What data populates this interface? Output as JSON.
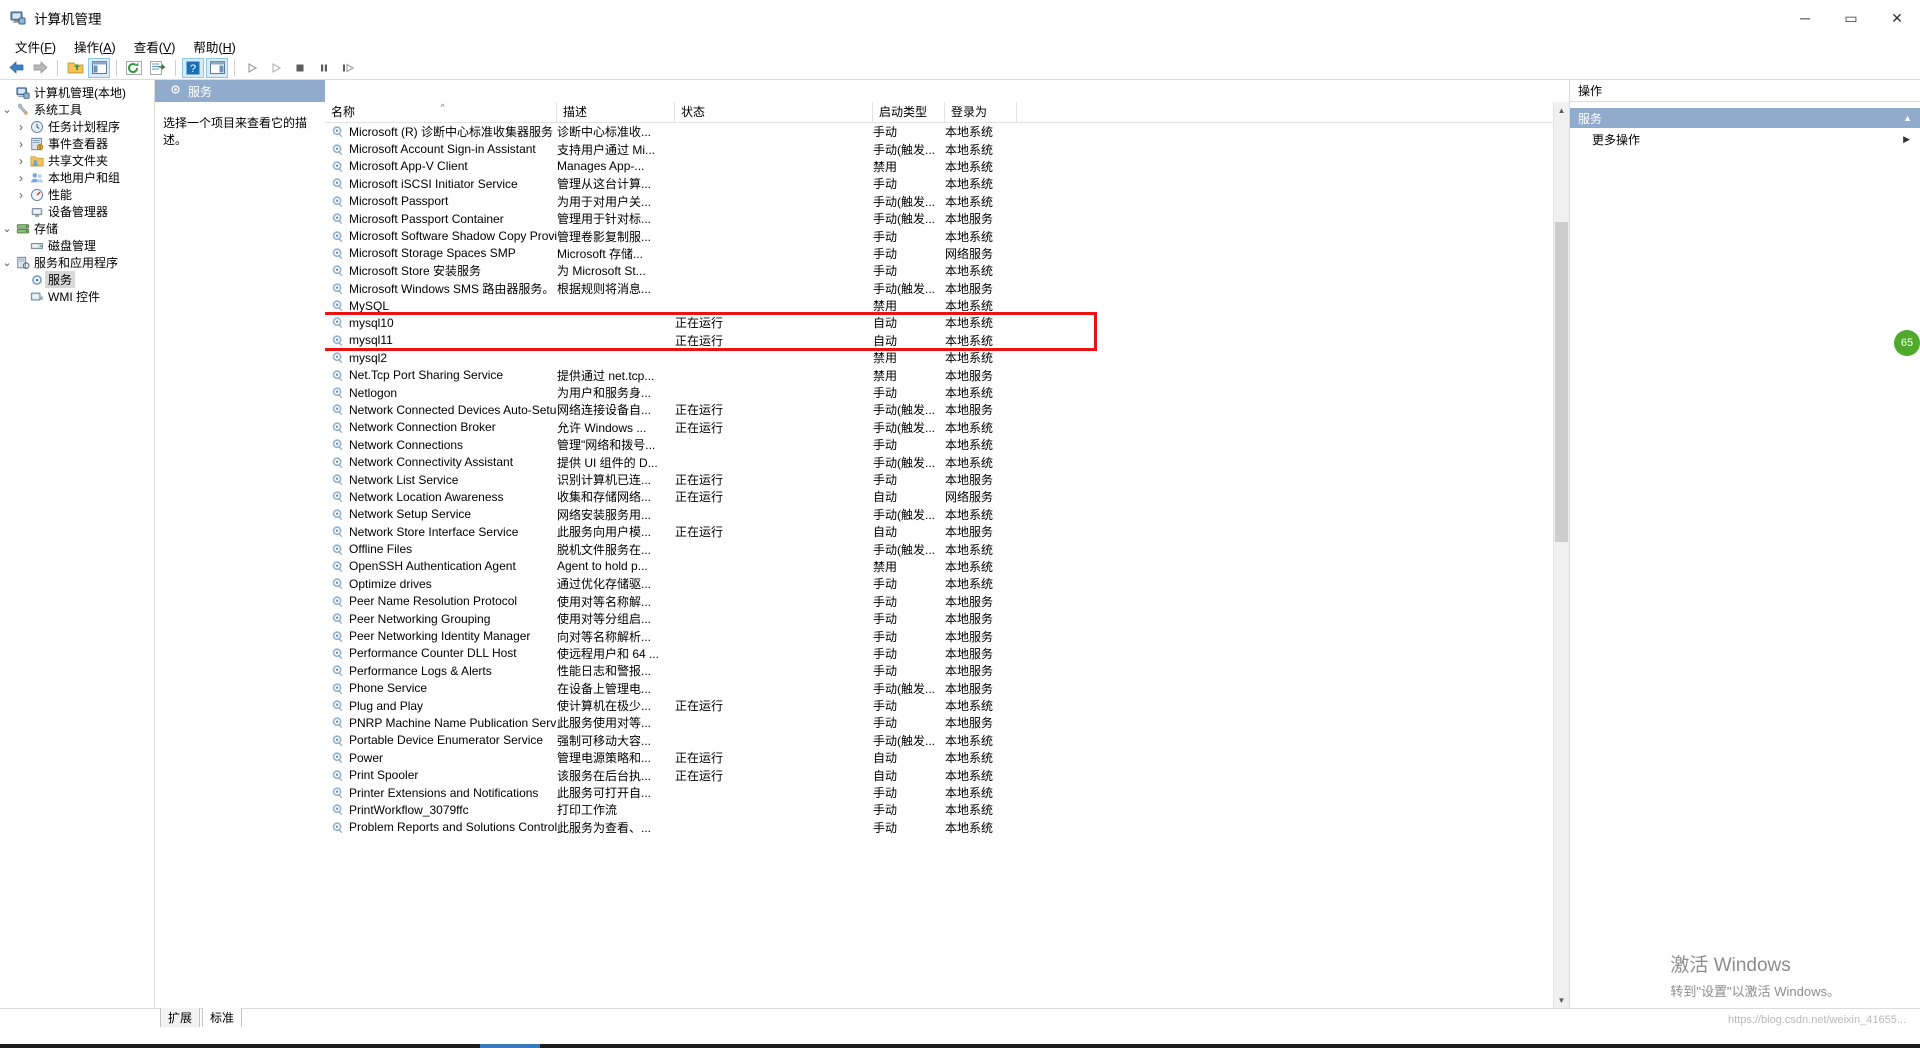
{
  "window": {
    "title": "计算机管理",
    "icon": "computer-management-icon",
    "controls": {
      "minimize": "─",
      "maximize": "▭",
      "close": "✕"
    }
  },
  "menu": [
    {
      "label": "文件",
      "accel": "F"
    },
    {
      "label": "操作",
      "accel": "A"
    },
    {
      "label": "查看",
      "accel": "V"
    },
    {
      "label": "帮助",
      "accel": "H"
    }
  ],
  "toolbar": {
    "buttons": [
      "back-arrow-icon",
      "forward-arrow-icon",
      "sep",
      "folder-up-icon",
      "show-hide-console-tree-icon",
      "sep",
      "refresh-icon",
      "export-list-icon",
      "sep",
      "help-icon",
      "show-action-pane-icon",
      "sep",
      "start-service-icon",
      "restart-service-icon",
      "stop-service-icon",
      "pause-service-icon",
      "resume-service-icon"
    ]
  },
  "tree": {
    "root": {
      "label": "计算机管理(本地)",
      "icon": "computer-icon",
      "expander": ""
    },
    "items": [
      {
        "label": "系统工具",
        "icon": "tools-icon",
        "expander": "v",
        "indent": 1
      },
      {
        "label": "任务计划程序",
        "icon": "clock-icon",
        "expander": ">",
        "indent": 2
      },
      {
        "label": "事件查看器",
        "icon": "event-log-icon",
        "expander": ">",
        "indent": 2
      },
      {
        "label": "共享文件夹",
        "icon": "shared-folder-icon",
        "expander": ">",
        "indent": 2
      },
      {
        "label": "本地用户和组",
        "icon": "users-icon",
        "expander": ">",
        "indent": 2
      },
      {
        "label": "性能",
        "icon": "performance-icon",
        "expander": ">",
        "indent": 2
      },
      {
        "label": "设备管理器",
        "icon": "device-manager-icon",
        "expander": "",
        "indent": 2
      },
      {
        "label": "存储",
        "icon": "storage-icon",
        "expander": "v",
        "indent": 1
      },
      {
        "label": "磁盘管理",
        "icon": "disk-icon",
        "expander": "",
        "indent": 2
      },
      {
        "label": "服务和应用程序",
        "icon": "services-apps-icon",
        "expander": "v",
        "indent": 1
      },
      {
        "label": "服务",
        "icon": "service-gear-icon",
        "expander": "",
        "indent": 2,
        "selected": true
      },
      {
        "label": "WMI 控件",
        "icon": "wmi-icon",
        "expander": "",
        "indent": 2
      }
    ]
  },
  "center": {
    "header_title": "服务",
    "header_icon": "service-gear-icon",
    "description_hint": "选择一个项目来查看它的描述。",
    "columns": [
      {
        "key": "name",
        "label": "名称",
        "sorted": true,
        "sort_arrow": "^"
      },
      {
        "key": "desc",
        "label": "描述"
      },
      {
        "key": "state",
        "label": "状态"
      },
      {
        "key": "start",
        "label": "启动类型"
      },
      {
        "key": "logon",
        "label": "登录为"
      }
    ],
    "rows": [
      {
        "name": "Microsoft (R) 诊断中心标准收集器服务",
        "desc": "诊断中心标准收...",
        "state": "",
        "start": "手动",
        "logon": "本地系统"
      },
      {
        "name": "Microsoft Account Sign-in Assistant",
        "desc": "支持用户通过 Mi...",
        "state": "",
        "start": "手动(触发...",
        "logon": "本地系统"
      },
      {
        "name": "Microsoft App-V Client",
        "desc": "Manages App-...",
        "state": "",
        "start": "禁用",
        "logon": "本地系统"
      },
      {
        "name": "Microsoft iSCSI Initiator Service",
        "desc": "管理从这台计算...",
        "state": "",
        "start": "手动",
        "logon": "本地系统"
      },
      {
        "name": "Microsoft Passport",
        "desc": "为用于对用户关...",
        "state": "",
        "start": "手动(触发...",
        "logon": "本地系统"
      },
      {
        "name": "Microsoft Passport Container",
        "desc": "管理用于针对标...",
        "state": "",
        "start": "手动(触发...",
        "logon": "本地服务"
      },
      {
        "name": "Microsoft Software Shadow Copy Provider",
        "desc": "管理卷影复制服...",
        "state": "",
        "start": "手动",
        "logon": "本地系统"
      },
      {
        "name": "Microsoft Storage Spaces SMP",
        "desc": "Microsoft 存储...",
        "state": "",
        "start": "手动",
        "logon": "网络服务"
      },
      {
        "name": "Microsoft Store 安装服务",
        "desc": "为 Microsoft St...",
        "state": "",
        "start": "手动",
        "logon": "本地系统"
      },
      {
        "name": "Microsoft Windows SMS 路由器服务。",
        "desc": "根据规则将消息...",
        "state": "",
        "start": "手动(触发...",
        "logon": "本地服务"
      },
      {
        "name": "MySQL",
        "desc": "",
        "state": "",
        "start": "禁用",
        "logon": "本地系统"
      },
      {
        "name": "mysql10",
        "desc": "",
        "state": "正在运行",
        "start": "自动",
        "logon": "本地系统",
        "highlighted": true
      },
      {
        "name": "mysql11",
        "desc": "",
        "state": "正在运行",
        "start": "自动",
        "logon": "本地系统",
        "highlighted": true
      },
      {
        "name": "mysql2",
        "desc": "",
        "state": "",
        "start": "禁用",
        "logon": "本地系统"
      },
      {
        "name": "Net.Tcp Port Sharing Service",
        "desc": "提供通过 net.tcp...",
        "state": "",
        "start": "禁用",
        "logon": "本地服务"
      },
      {
        "name": "Netlogon",
        "desc": "为用户和服务身...",
        "state": "",
        "start": "手动",
        "logon": "本地系统"
      },
      {
        "name": "Network Connected Devices Auto-Setup",
        "desc": "网络连接设备自...",
        "state": "正在运行",
        "start": "手动(触发...",
        "logon": "本地服务"
      },
      {
        "name": "Network Connection Broker",
        "desc": "允许 Windows ...",
        "state": "正在运行",
        "start": "手动(触发...",
        "logon": "本地系统"
      },
      {
        "name": "Network Connections",
        "desc": "管理\"网络和拨号...",
        "state": "",
        "start": "手动",
        "logon": "本地系统"
      },
      {
        "name": "Network Connectivity Assistant",
        "desc": "提供 UI 组件的 D...",
        "state": "",
        "start": "手动(触发...",
        "logon": "本地系统"
      },
      {
        "name": "Network List Service",
        "desc": "识别计算机已连...",
        "state": "正在运行",
        "start": "手动",
        "logon": "本地服务"
      },
      {
        "name": "Network Location Awareness",
        "desc": "收集和存储网络...",
        "state": "正在运行",
        "start": "自动",
        "logon": "网络服务"
      },
      {
        "name": "Network Setup Service",
        "desc": "网络安装服务用...",
        "state": "",
        "start": "手动(触发...",
        "logon": "本地系统"
      },
      {
        "name": "Network Store Interface Service",
        "desc": "此服务向用户模...",
        "state": "正在运行",
        "start": "自动",
        "logon": "本地服务"
      },
      {
        "name": "Offline Files",
        "desc": "脱机文件服务在...",
        "state": "",
        "start": "手动(触发...",
        "logon": "本地系统"
      },
      {
        "name": "OpenSSH Authentication Agent",
        "desc": "Agent to hold p...",
        "state": "",
        "start": "禁用",
        "logon": "本地系统"
      },
      {
        "name": "Optimize drives",
        "desc": "通过优化存储驱...",
        "state": "",
        "start": "手动",
        "logon": "本地系统"
      },
      {
        "name": "Peer Name Resolution Protocol",
        "desc": "使用对等名称解...",
        "state": "",
        "start": "手动",
        "logon": "本地服务"
      },
      {
        "name": "Peer Networking Grouping",
        "desc": "使用对等分组启...",
        "state": "",
        "start": "手动",
        "logon": "本地服务"
      },
      {
        "name": "Peer Networking Identity Manager",
        "desc": "向对等名称解析...",
        "state": "",
        "start": "手动",
        "logon": "本地服务"
      },
      {
        "name": "Performance Counter DLL Host",
        "desc": "使远程用户和 64 ...",
        "state": "",
        "start": "手动",
        "logon": "本地服务"
      },
      {
        "name": "Performance Logs & Alerts",
        "desc": "性能日志和警报...",
        "state": "",
        "start": "手动",
        "logon": "本地服务"
      },
      {
        "name": "Phone Service",
        "desc": "在设备上管理电...",
        "state": "",
        "start": "手动(触发...",
        "logon": "本地服务"
      },
      {
        "name": "Plug and Play",
        "desc": "使计算机在极少...",
        "state": "正在运行",
        "start": "手动",
        "logon": "本地系统"
      },
      {
        "name": "PNRP Machine Name Publication Service",
        "desc": "此服务使用对等...",
        "state": "",
        "start": "手动",
        "logon": "本地服务"
      },
      {
        "name": "Portable Device Enumerator Service",
        "desc": "强制可移动大容...",
        "state": "",
        "start": "手动(触发...",
        "logon": "本地系统"
      },
      {
        "name": "Power",
        "desc": "管理电源策略和...",
        "state": "正在运行",
        "start": "自动",
        "logon": "本地系统"
      },
      {
        "name": "Print Spooler",
        "desc": "该服务在后台执...",
        "state": "正在运行",
        "start": "自动",
        "logon": "本地系统"
      },
      {
        "name": "Printer Extensions and Notifications",
        "desc": "此服务可打开自...",
        "state": "",
        "start": "手动",
        "logon": "本地系统"
      },
      {
        "name": "PrintWorkflow_3079ffc",
        "desc": "打印工作流",
        "state": "",
        "start": "手动",
        "logon": "本地系统"
      },
      {
        "name": "Problem Reports and Solutions Control Pan...",
        "desc": "此服务为查看、...",
        "state": "",
        "start": "手动",
        "logon": "本地系统"
      }
    ]
  },
  "right": {
    "title": "操作",
    "section_label": "服务",
    "items": [
      {
        "label": "更多操作",
        "caret": "▶"
      }
    ]
  },
  "bottom_tabs": [
    {
      "label": "扩展",
      "active": false
    },
    {
      "label": "标准",
      "active": true
    }
  ],
  "watermark": {
    "line1": "激活 Windows",
    "line2": "转到\"设置\"以激活 Windows。"
  },
  "blog_link": "https://blog.csdn.net/weixin_41655...",
  "badge": {
    "label": "65"
  },
  "colors": {
    "accent_header": "#91abcd",
    "annotation_red": "#ee1111",
    "selection_gray": "#d8d8d8",
    "badge_green": "#4faa2b"
  }
}
